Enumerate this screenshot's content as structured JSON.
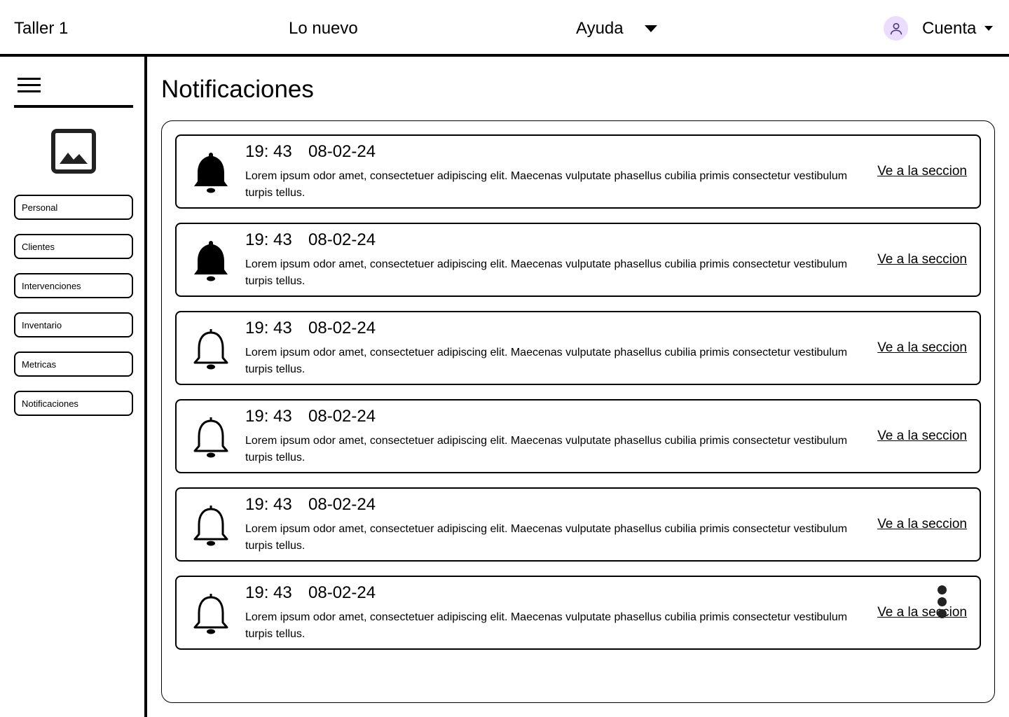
{
  "header": {
    "brand": "Taller 1",
    "nav_new": "Lo nuevo",
    "nav_help": "Ayuda",
    "account": "Cuenta"
  },
  "sidebar": {
    "items": [
      {
        "label": "Personal"
      },
      {
        "label": "Clientes"
      },
      {
        "label": "Intervenciones"
      },
      {
        "label": "Inventario"
      },
      {
        "label": "Metricas"
      },
      {
        "label": "Notificaciones"
      }
    ]
  },
  "main": {
    "title": "Notificaciones",
    "notifications": [
      {
        "time": "19: 43",
        "date": "08-02-24",
        "message": "Lorem ipsum odor amet, consectetuer adipiscing elit. Maecenas vulputate phasellus cubilia primis consectetur vestibulum turpis tellus.",
        "link": "Ve a la seccion",
        "unread": true
      },
      {
        "time": "19: 43",
        "date": "08-02-24",
        "message": "Lorem ipsum odor amet, consectetuer adipiscing elit. Maecenas vulputate phasellus cubilia primis consectetur vestibulum turpis tellus.",
        "link": "Ve a la seccion",
        "unread": true
      },
      {
        "time": "19: 43",
        "date": "08-02-24",
        "message": "Lorem ipsum odor amet, consectetuer adipiscing elit. Maecenas vulputate phasellus cubilia primis consectetur vestibulum turpis tellus.",
        "link": "Ve a la seccion",
        "unread": false
      },
      {
        "time": "19: 43",
        "date": "08-02-24",
        "message": "Lorem ipsum odor amet, consectetuer adipiscing elit. Maecenas vulputate phasellus cubilia primis consectetur vestibulum turpis tellus.",
        "link": "Ve a la seccion",
        "unread": false
      },
      {
        "time": "19: 43",
        "date": "08-02-24",
        "message": "Lorem ipsum odor amet, consectetuer adipiscing elit. Maecenas vulputate phasellus cubilia primis consectetur vestibulum turpis tellus.",
        "link": "Ve a la seccion",
        "unread": false
      },
      {
        "time": "19: 43",
        "date": "08-02-24",
        "message": "Lorem ipsum odor amet, consectetuer adipiscing elit. Maecenas vulputate phasellus cubilia primis consectetur vestibulum turpis tellus.",
        "link": "Ve a la seccion",
        "unread": false
      }
    ]
  },
  "icons": {
    "menu": "hamburger-menu-icon",
    "logo": "image-placeholder-icon",
    "avatar": "person-icon",
    "help_caret": "caret-down-icon",
    "account_caret": "caret-down-icon",
    "notification_unread": "bell-filled-icon",
    "notification_read": "bell-outline-icon",
    "more": "more-vertical-icon"
  },
  "colors": {
    "avatar_bg": "#eaddff",
    "avatar_fg": "#4f378b"
  }
}
